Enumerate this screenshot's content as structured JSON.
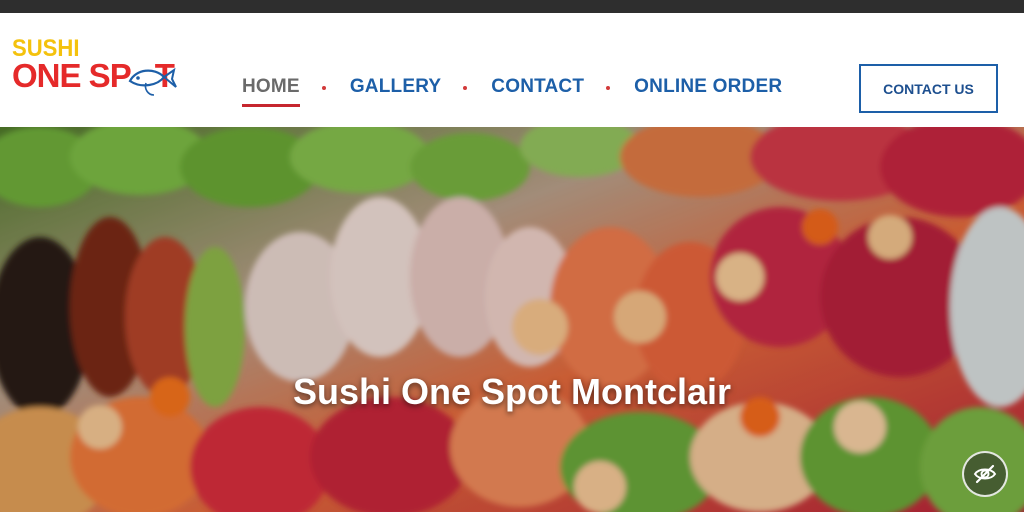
{
  "logo": {
    "line1": "SUSHI",
    "line2": "ONE SP",
    "line2_suffix": "T",
    "colors": {
      "top": "#f4c20d",
      "bottom": "#e52a2a",
      "fish": "#1d5fa8"
    }
  },
  "nav": {
    "items": [
      {
        "label": "HOME",
        "active": true
      },
      {
        "label": "GALLERY",
        "active": false
      },
      {
        "label": "CONTACT",
        "active": false
      },
      {
        "label": "ONLINE ORDER",
        "active": false
      }
    ],
    "link_color": "#1d5fa8",
    "active_color": "#6a6a6a",
    "underline_color": "#c6262e"
  },
  "header_button": {
    "label": "CONTACT US"
  },
  "hero": {
    "title": "Sushi One Spot Montclair",
    "image": "sushi-platter-photo"
  },
  "floating_button": {
    "icon": "eye-slash-icon"
  }
}
